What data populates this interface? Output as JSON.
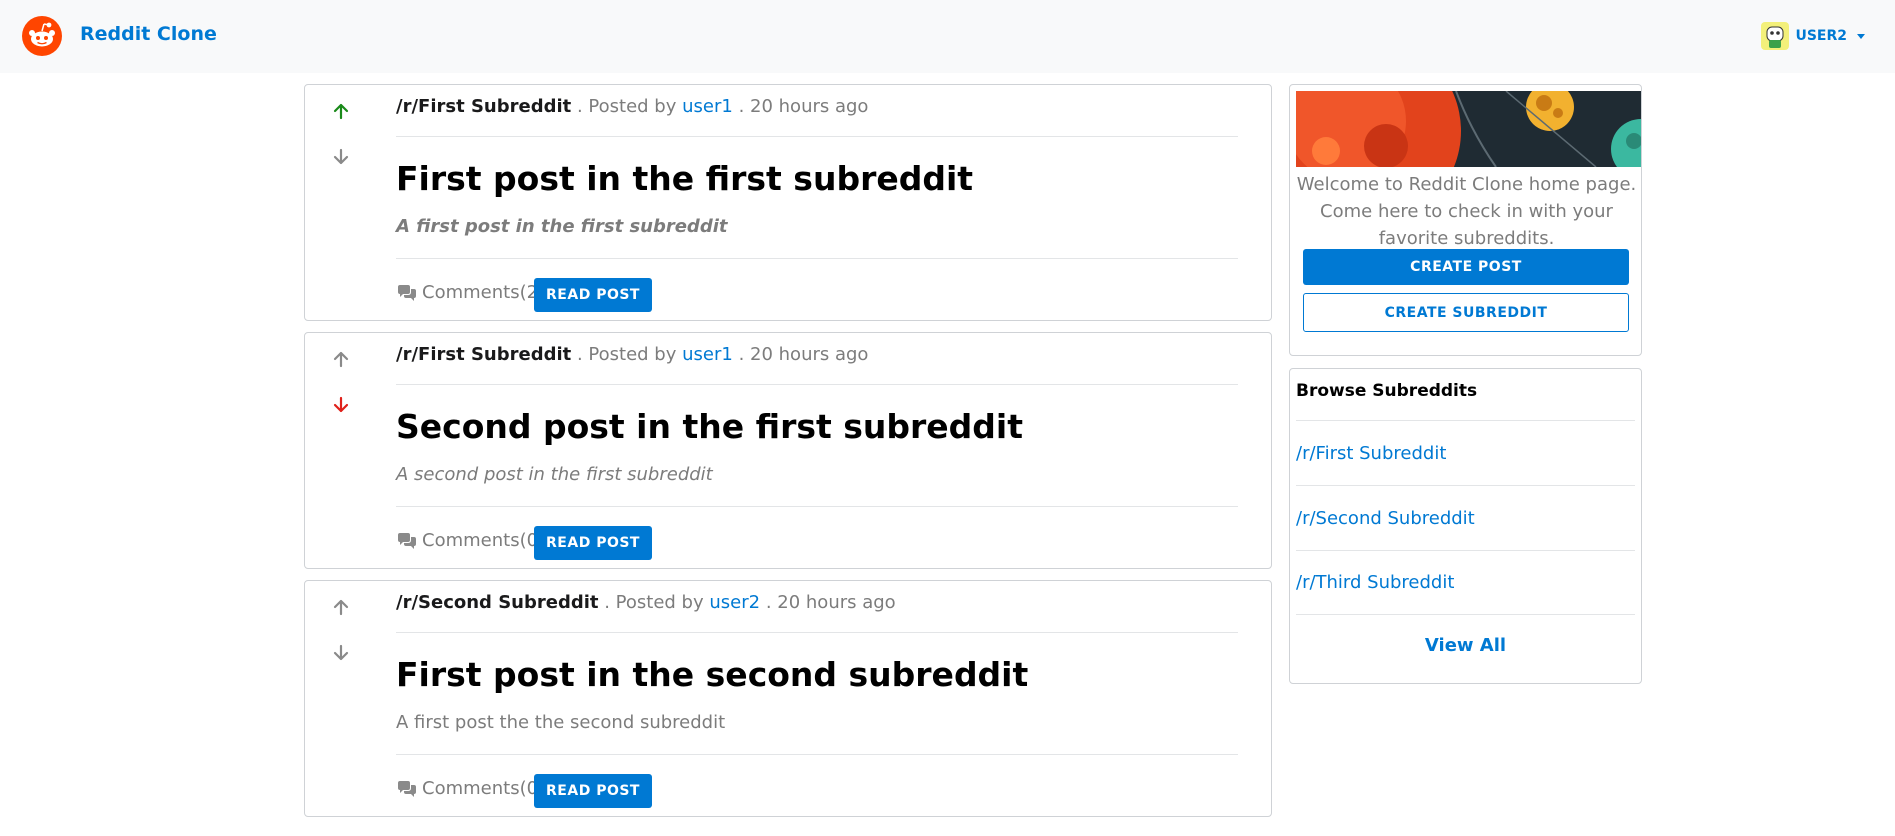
{
  "header": {
    "brand": "Reddit Clone",
    "username": "USER2"
  },
  "posts": [
    {
      "subreddit": "/r/First Subreddit",
      "posted_by_prefix": ". Posted by",
      "author": "user1",
      "time": ". 20 hours ago",
      "title": "First post in the first subreddit",
      "description": "A first post in the first subreddit",
      "comments": "Comments(2)",
      "read_label": "READ POST",
      "vote": "up"
    },
    {
      "subreddit": "/r/First Subreddit",
      "posted_by_prefix": ". Posted by",
      "author": "user1",
      "time": ". 20 hours ago",
      "title": "Second post in the first subreddit",
      "description": "A second post in the first subreddit",
      "comments": "Comments(0)",
      "read_label": "READ POST",
      "vote": "down"
    },
    {
      "subreddit": "/r/Second Subreddit",
      "posted_by_prefix": ". Posted by",
      "author": "user2",
      "time": ". 20 hours ago",
      "title": "First post in the second subreddit",
      "description": "A first post the the second subreddit",
      "comments": "Comments(0)",
      "read_label": "READ POST",
      "vote": "none"
    }
  ],
  "sidebar": {
    "welcome_text": "Welcome to Reddit Clone home page. Come here to check in with your favorite subreddits.",
    "create_post_label": "CREATE POST",
    "create_subreddit_label": "CREATE SUBREDDIT",
    "browse_title": "Browse Subreddits",
    "subreddits": [
      "/r/First Subreddit",
      "/r/Second Subreddit",
      "/r/Third Subreddit"
    ],
    "view_all_label": "View All"
  },
  "colors": {
    "accent": "#0079d3",
    "upvote_active": "#1a8a1a",
    "downvote_active": "#e0201a",
    "vote_inactive": "#8a8a8a",
    "logo": "#ff4500"
  },
  "icons": {
    "logo": "reddit-logo-icon",
    "upvote": "arrow-up-icon",
    "downvote": "arrow-down-icon",
    "comments": "comments-icon",
    "dropdown": "chevron-down-icon"
  }
}
